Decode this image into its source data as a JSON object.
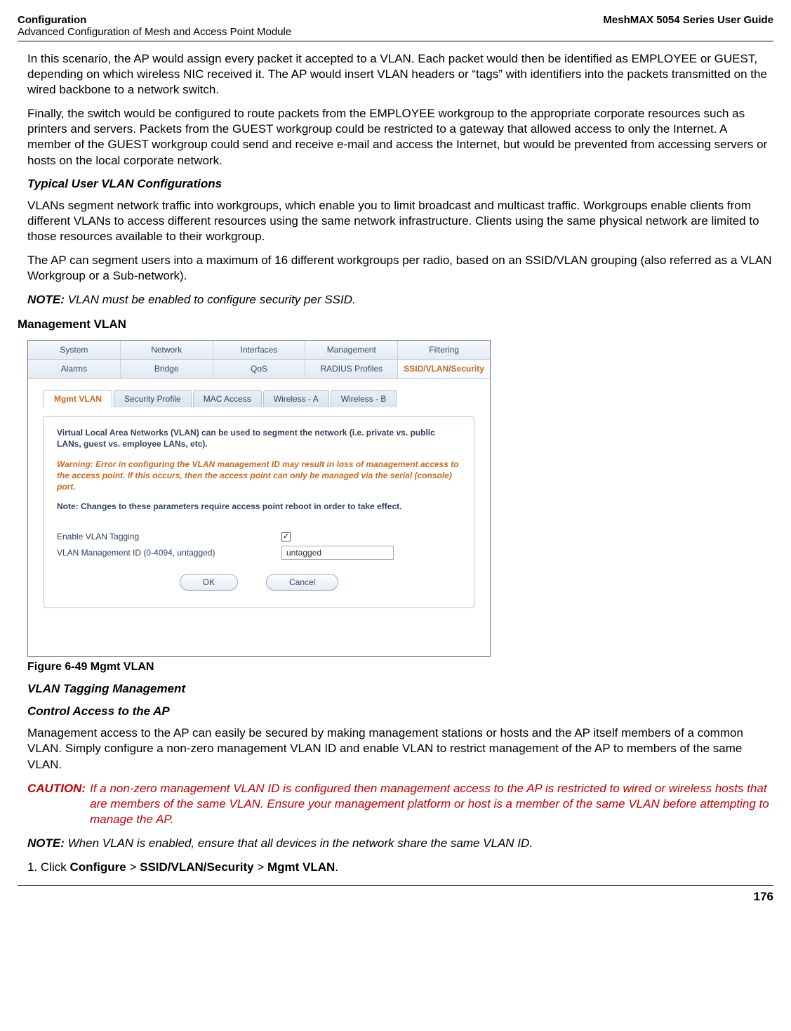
{
  "header": {
    "left_bold": "Configuration",
    "left_sub": "Advanced Configuration of Mesh and Access Point Module",
    "right": "MeshMAX 5054 Series User Guide"
  },
  "p1": "In this scenario, the AP would assign every packet it accepted to a VLAN. Each packet would then be identified as EMPLOYEE or GUEST, depending on which wireless NIC received it. The AP would insert VLAN headers or “tags” with identifiers into the packets transmitted on the wired backbone to a network switch.",
  "p2": "Finally, the switch would be configured to route packets from the EMPLOYEE workgroup to the appropriate corporate resources such as printers and servers. Packets from the GUEST workgroup could be restricted to a gateway that allowed access to only the Internet. A member of the GUEST workgroup could send and receive e-mail and access the Internet, but would be prevented from accessing servers or hosts on the local corporate network.",
  "h_typical": "Typical User VLAN Configurations",
  "p3": "VLANs segment network traffic into workgroups, which enable you to limit broadcast and multicast traffic. Workgroups enable clients from different VLANs to access different resources using the same network infrastructure. Clients using the same physical network are limited to those resources available to their workgroup.",
  "p4": "The AP can segment users into a maximum of 16 different workgroups per radio, based on an SSID/VLAN grouping (also referred as a VLAN Workgroup or a Sub-network).",
  "note1_lbl": "NOTE:",
  "note1_txt": "VLAN must be enabled to configure security per SSID.",
  "h_mgmt": "Management VLAN",
  "fig_caption": "Figure 6-49 Mgmt VLAN",
  "h_vlan_tag": "VLAN Tagging Management",
  "h_control": "Control Access to the AP",
  "p5": "Management access to the AP can easily be secured by making management stations or hosts and the AP itself members of a common VLAN. Simply configure a non-zero management VLAN ID and enable VLAN to restrict management of the AP to members of the same VLAN.",
  "caution_lbl": "CAUTION:",
  "caution_txt": "If a non-zero management VLAN ID is configured then management access to the AP is restricted to wired or wireless hosts that are members of the same VLAN. Ensure your management platform or host is a member of the same VLAN before attempting to manage the AP.",
  "note2_lbl": "NOTE:",
  "note2_txt": "When VLAN is enabled, ensure that all devices in the network share the same VLAN ID.",
  "step1_pre": "1.  Click ",
  "step1_b1": "Configure",
  "step1_gt1": " > ",
  "step1_b2": "SSID/VLAN/Security",
  "step1_gt2": " > ",
  "step1_b3": "Mgmt VLAN",
  "step1_suffix": ".",
  "page_num": "176",
  "shot": {
    "tabs1": [
      "System",
      "Network",
      "Interfaces",
      "Management",
      "Filtering"
    ],
    "tabs2": [
      "Alarms",
      "Bridge",
      "QoS",
      "RADIUS Profiles",
      "SSID/VLAN/Security"
    ],
    "tabs2_active": "SSID/VLAN/Security",
    "subtabs": [
      "Mgmt VLAN",
      "Security Profile",
      "MAC Access",
      "Wireless - A",
      "Wireless - B"
    ],
    "subtabs_active": "Mgmt VLAN",
    "desc1": "Virtual Local Area Networks (VLAN) can be used to segment the network (i.e. private vs. public LANs, guest vs. employee LANs, etc).",
    "warn": "Warning: Error in configuring the VLAN management ID may result in loss of management access to the access point. If this occurs, then the access point can only be managed via the serial (console) port.",
    "desc2": "Note: Changes to these parameters require access point reboot in order to take effect.",
    "label_enable": "Enable VLAN Tagging",
    "label_vid": "VLAN Management ID (0-4094, untagged)",
    "vid_value": "untagged",
    "checkbox_checked": "✓",
    "btn_ok": "OK",
    "btn_cancel": "Cancel"
  }
}
